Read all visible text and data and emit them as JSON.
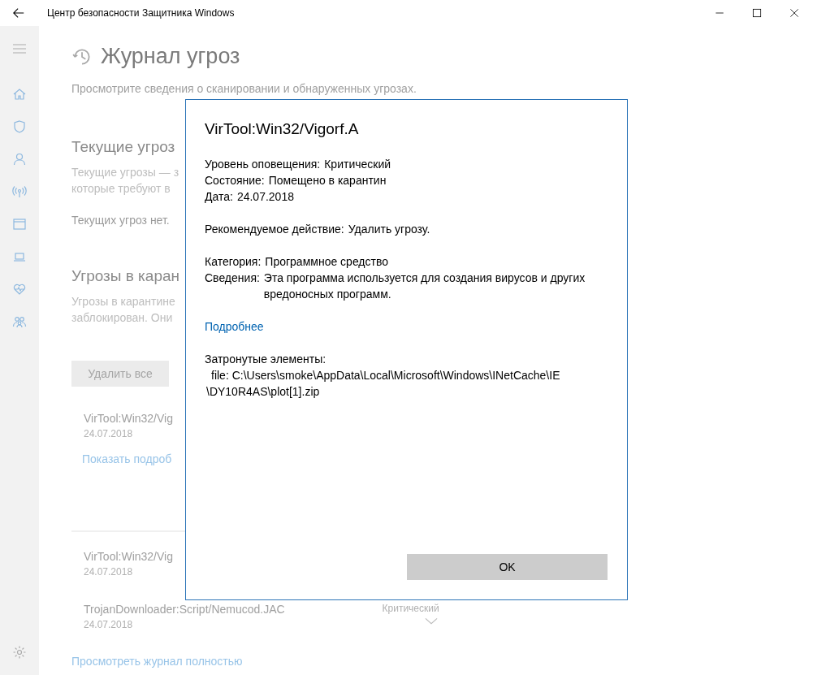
{
  "window": {
    "title": "Центр безопасности Защитника Windows"
  },
  "page": {
    "title": "Журнал угроз",
    "subtitle": "Просмотрите сведения о сканировании и обнаруженных угрозах."
  },
  "current_threats": {
    "heading": "Текущие угроз",
    "description": [
      "Текущие угрозы — з",
      "которые требуют в"
    ],
    "status": "Текущих угроз нет."
  },
  "quarantine": {
    "heading": "Угрозы в каран",
    "description": [
      "Угрозы в карантине",
      "заблокирован. Они"
    ],
    "button": "Удалить все",
    "items": [
      {
        "name": "VirTool:Win32/Vig",
        "date": "24.07.2018",
        "link": "Показать подроб"
      }
    ]
  },
  "history": {
    "items": [
      {
        "name": "VirTool:Win32/Vig",
        "date": "24.07.2018"
      },
      {
        "name": "TrojanDownloader:Script/Nemucod.JAC",
        "date": "24.07.2018",
        "level": "Критический",
        "expanded": false
      }
    ]
  },
  "footer_link": "Просмотреть журнал полностью",
  "dialog": {
    "title": "VirTool:Win32/Vigorf.A",
    "groups": [
      [
        {
          "label": "Уровень оповещения:",
          "value": "Критический"
        },
        {
          "label": "Состояние:",
          "value": "Помещено в карантин"
        },
        {
          "label": "Дата:",
          "value": "24.07.2018"
        }
      ],
      [
        {
          "label": "Рекомендуемое действие:",
          "value": "Удалить угрозу."
        }
      ],
      [
        {
          "label": "Категория:",
          "value": "Программное средство"
        },
        {
          "label": "Сведения:",
          "value": "Эта программа используется для создания вирусов и других вредоносных программ."
        }
      ]
    ],
    "link": "Подробнее",
    "affected_heading": "Затронутые элементы:",
    "affected_lines": [
      "file: C:\\Users\\smoke\\AppData\\Local\\Microsoft\\Windows\\INetCache\\IE",
      "\\DY10R4AS\\plot[1].zip"
    ],
    "button": "OK"
  }
}
